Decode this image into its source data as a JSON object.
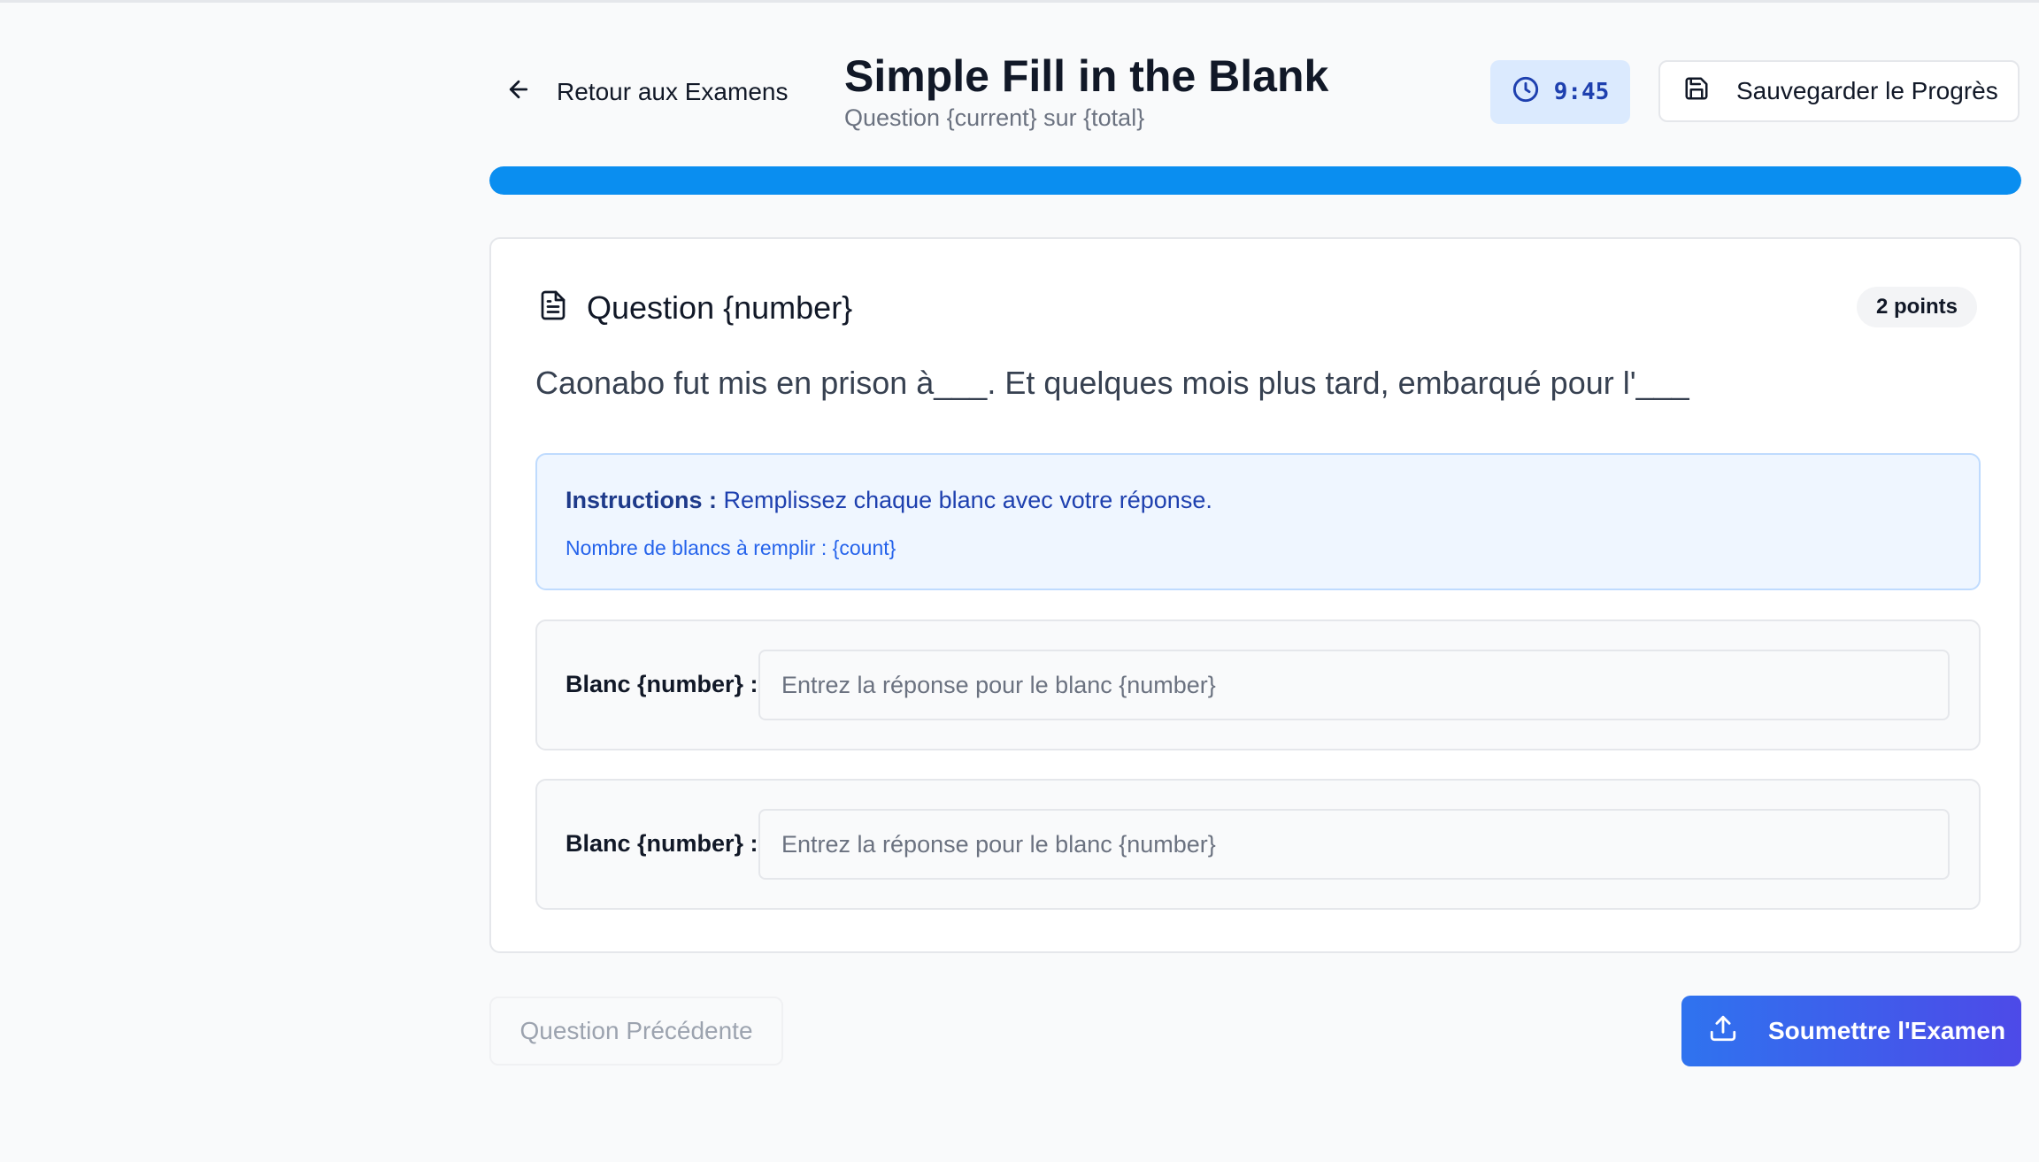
{
  "header": {
    "back_label": "Retour aux Examens",
    "title": "Simple Fill in the Blank",
    "subtitle": "Question {current} sur {total}",
    "timer": "9:45",
    "save_label": "Sauvegarder le Progrès"
  },
  "progress": {
    "fraction": 1.0
  },
  "question": {
    "title": "Question {number}",
    "points": "2 points",
    "text": "Caonabo fut mis en prison à___. Et quelques mois plus tard, embarqué pour l'___"
  },
  "instructions": {
    "label": "Instructions :",
    "text": "Remplissez chaque blanc avec votre réponse.",
    "count_text": "Nombre de blancs à remplir : {count}"
  },
  "blanks": [
    {
      "label": "Blanc {number} :",
      "value": "",
      "placeholder": "Entrez la réponse pour le blanc {number}"
    },
    {
      "label": "Blanc {number} :",
      "value": "",
      "placeholder": "Entrez la réponse pour le blanc {number}"
    }
  ],
  "footer": {
    "prev_label": "Question Précédente",
    "submit_label": "Soumettre l'Examen"
  },
  "icons": {
    "back": "arrow-left-icon",
    "timer": "clock-icon",
    "save": "save-icon",
    "question": "document-icon",
    "submit": "upload-icon"
  },
  "colors": {
    "progress": "#0a8ef0",
    "timer_bg": "#dbeafe",
    "submit_start": "#2f73ef",
    "submit_end": "#4d4ae8"
  }
}
